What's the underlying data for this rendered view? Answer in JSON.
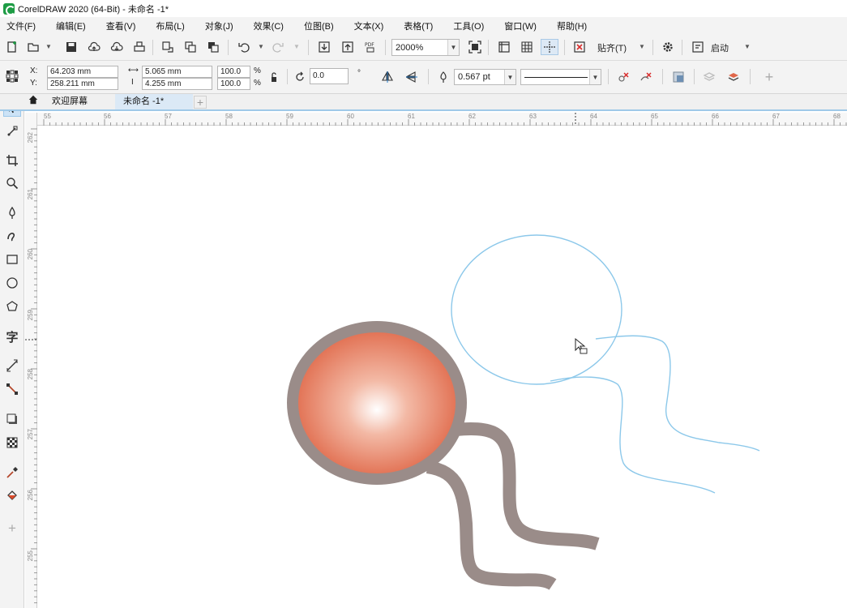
{
  "window": {
    "title": "CorelDRAW 2020 (64-Bit) - 未命名 -1*"
  },
  "menu": [
    "文件(F)",
    "编辑(E)",
    "查看(V)",
    "布局(L)",
    "对象(J)",
    "效果(C)",
    "位图(B)",
    "文本(X)",
    "表格(T)",
    "工具(O)",
    "窗口(W)",
    "帮助(H)"
  ],
  "toolbar": {
    "zoom_value": "2000%",
    "snap_label": "贴齐(T)",
    "launch_label": "启动"
  },
  "property_bar": {
    "x_label": "X:",
    "y_label": "Y:",
    "x_value": "64.203 mm",
    "y_value": "258.211 mm",
    "width_value": "5.065 mm",
    "height_value": "4.255 mm",
    "scale_x": "100.0",
    "scale_y": "100.0",
    "percent_symbol": "%",
    "rotation_value": "0.0",
    "degree_symbol": "°",
    "outline_width": "0.567 pt"
  },
  "tabs": {
    "welcome": "欢迎屏幕",
    "document": "未命名 -1*"
  },
  "rulers": {
    "horizontal": [
      "55",
      "56",
      "57",
      "58",
      "59",
      "60",
      "61",
      "62",
      "63",
      "64",
      "65",
      "66",
      "67",
      "68"
    ],
    "vertical": [
      "262",
      "261",
      "260",
      "259",
      "258",
      "257",
      "256",
      "255"
    ]
  },
  "colors": {
    "accent": "#9fc9e8",
    "selected_outline": "#8cc8ea",
    "ball_fill": "#e06a4b",
    "ball_outline": "#9a8c89"
  }
}
